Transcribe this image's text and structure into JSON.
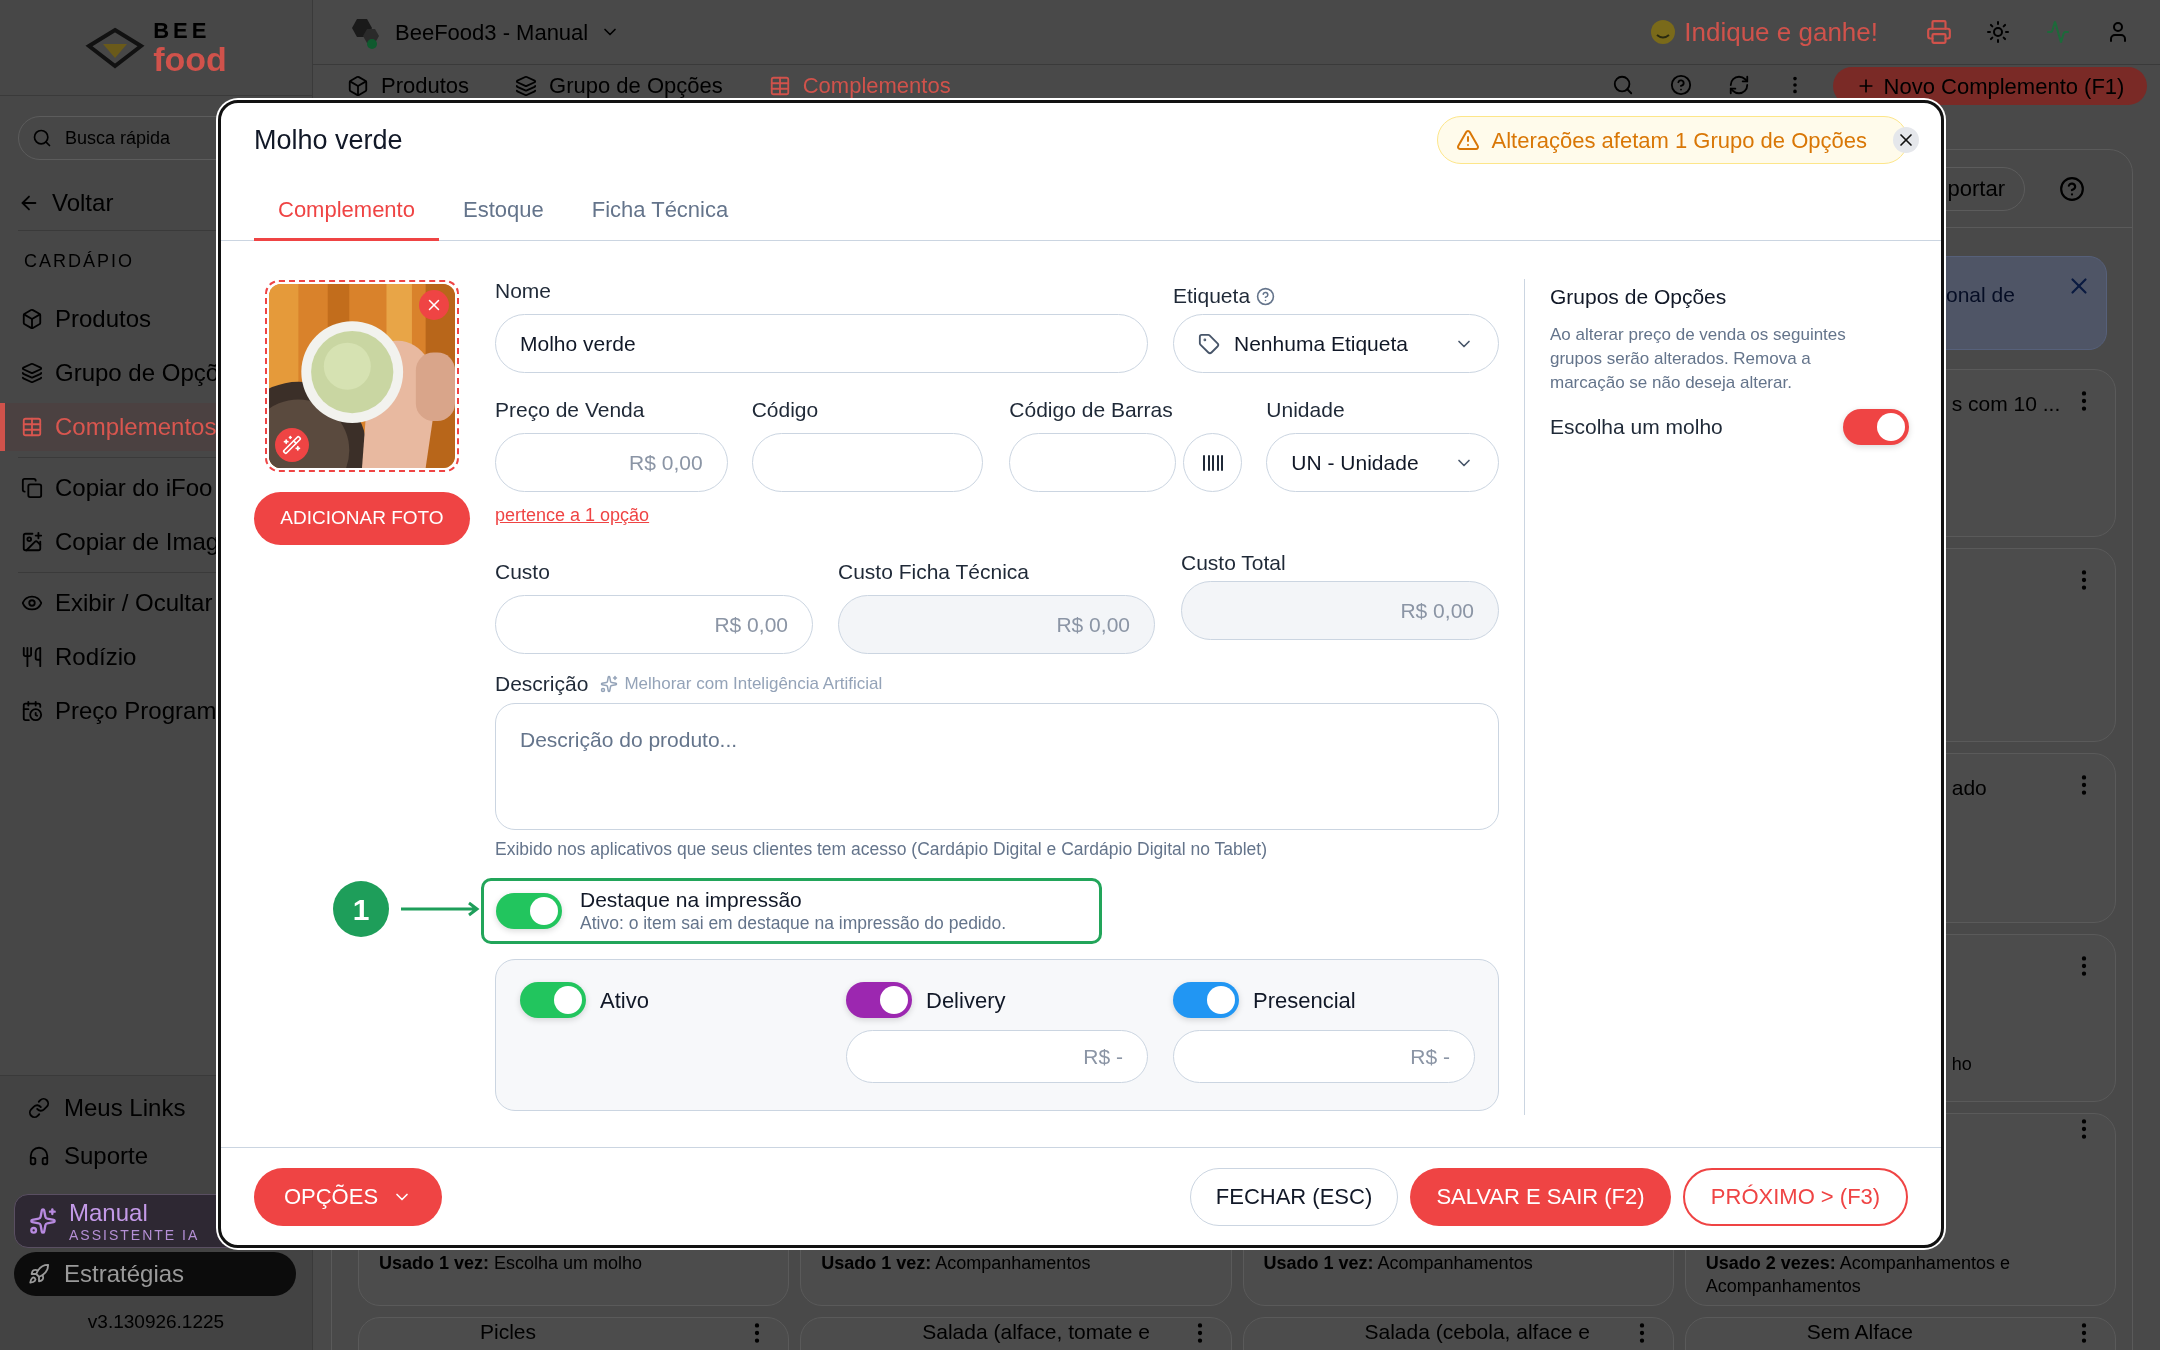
{
  "topbar": {
    "logo_top": "BEE",
    "logo_bottom": "food",
    "workspace": "BeeFood3 - Manual",
    "referral": "Indique e ganhe!"
  },
  "sidebar": {
    "search_placeholder": "Busca rápida",
    "back": "Voltar",
    "section": "CARDÁPIO",
    "items": [
      {
        "label": "Produtos",
        "selected": false
      },
      {
        "label": "Grupo de Opçõ",
        "selected": false
      },
      {
        "label": "Complementos",
        "selected": true
      },
      {
        "label": "Copiar do iFoo",
        "selected": false
      },
      {
        "label": "Copiar de Imag",
        "selected": false
      },
      {
        "label": "Exibir / Ocultar",
        "selected": false
      },
      {
        "label": "Rodízio",
        "selected": false
      },
      {
        "label": "Preço Program",
        "selected": false
      }
    ],
    "footer_links": [
      "Meus Links",
      "Suporte"
    ],
    "assistant": {
      "title": "Manual",
      "subtitle": "ASSISTENTE IA"
    },
    "strategies": "Estratégias",
    "version": "v3.130926.1225"
  },
  "section_tabs": [
    {
      "label": "Produtos",
      "selected": false
    },
    {
      "label": "Grupo de Opções",
      "selected": false
    },
    {
      "label": "Complementos",
      "selected": true
    }
  ],
  "new_button": "Novo Complemento (F1)",
  "content": {
    "import_button": "portar",
    "banner": "onal de",
    "cards": [
      {
        "kind": "clipped",
        "title": "s com 10 ...",
        "more": true
      },
      {
        "kind": "clipped",
        "more": true
      },
      {
        "kind": "clipped",
        "title": "ado",
        "more": true
      },
      {
        "kind": "clipped",
        "subtitle": "ho",
        "more": true
      },
      {
        "kind": "full",
        "subtitle": "**Usado 1 vez:** Escolha um molho"
      },
      {
        "kind": "full",
        "subtitle": "**Usado 1 vez:** Acompanhamentos"
      },
      {
        "kind": "full",
        "subtitle": "**Usado 1 vez:** Acompanhamentos"
      },
      {
        "kind": "full",
        "subtitle": "**Usado 2 vezes:** Acompanhamentos e Acompanhamentos",
        "more": true
      },
      {
        "kind": "full",
        "title": "Picles",
        "more": true
      },
      {
        "kind": "full",
        "title": "Salada (alface, tomate e",
        "more": true
      },
      {
        "kind": "full",
        "title": "Salada (cebola, alface e",
        "more": true
      },
      {
        "kind": "full",
        "title": "Sem Alface",
        "more": true
      }
    ]
  },
  "modal": {
    "title": "Molho verde",
    "warning": "Alterações afetam 1 Grupo de Opções",
    "tabs": [
      {
        "label": "Complemento",
        "selected": true
      },
      {
        "label": "Estoque",
        "selected": false
      },
      {
        "label": "Ficha Técnica",
        "selected": false
      }
    ],
    "add_photo": "ADICIONAR FOTO",
    "name": {
      "label": "Nome",
      "value": "Molho verde"
    },
    "tag": {
      "label": "Etiqueta",
      "value": "Nenhuma Etiqueta"
    },
    "price": {
      "label": "Preço de Venda",
      "placeholder": "R$ 0,00"
    },
    "code": {
      "label": "Código"
    },
    "barcode": {
      "label": "Código de Barras"
    },
    "unit": {
      "label": "Unidade",
      "value": "UN - Unidade"
    },
    "option_link": "pertence a 1 opção",
    "cost": {
      "label": "Custo",
      "placeholder": "R$ 0,00",
      "disabled": false
    },
    "sheet_cost": {
      "label": "Custo Ficha Técnica",
      "placeholder": "R$ 0,00",
      "disabled": true
    },
    "total_cost": {
      "label": "Custo Total",
      "placeholder": "R$ 0,00",
      "disabled": true
    },
    "description": {
      "label": "Descrição",
      "ai_hint": "Melhorar com Inteligência Artificial",
      "placeholder": "Descrição do produto...",
      "help": "Exibido nos aplicativos que seus clientes tem acesso (Cardápio Digital e Cardápio Digital no Tablet)"
    },
    "highlight": {
      "callout": "1",
      "title": "Destaque na impressão",
      "hint": "Ativo: o item sai em destaque na impressão do pedido.",
      "on": true,
      "color": "#22c55e"
    },
    "channels": [
      {
        "label": "Ativo",
        "on": true,
        "color": "#22c55e"
      },
      {
        "label": "Delivery",
        "on": true,
        "color": "#9c27b0",
        "price_placeholder": "R$ -"
      },
      {
        "label": "Presencial",
        "on": true,
        "color": "#2196f3",
        "price_placeholder": "R$ -"
      }
    ],
    "groups": {
      "title": "Grupos de Opções",
      "description": "Ao alterar preço de venda os seguintes grupos serão alterados. Remova a marcação se não deseja alterar.",
      "items": [
        {
          "label": "Escolha um molho",
          "on": true,
          "color": "#ef4444"
        }
      ]
    },
    "footer": {
      "options": "OPÇÕES",
      "close": "FECHAR (ESC)",
      "save": "SALVAR E SAIR (F2)",
      "next": "PRÓXIMO > (F3)"
    }
  }
}
